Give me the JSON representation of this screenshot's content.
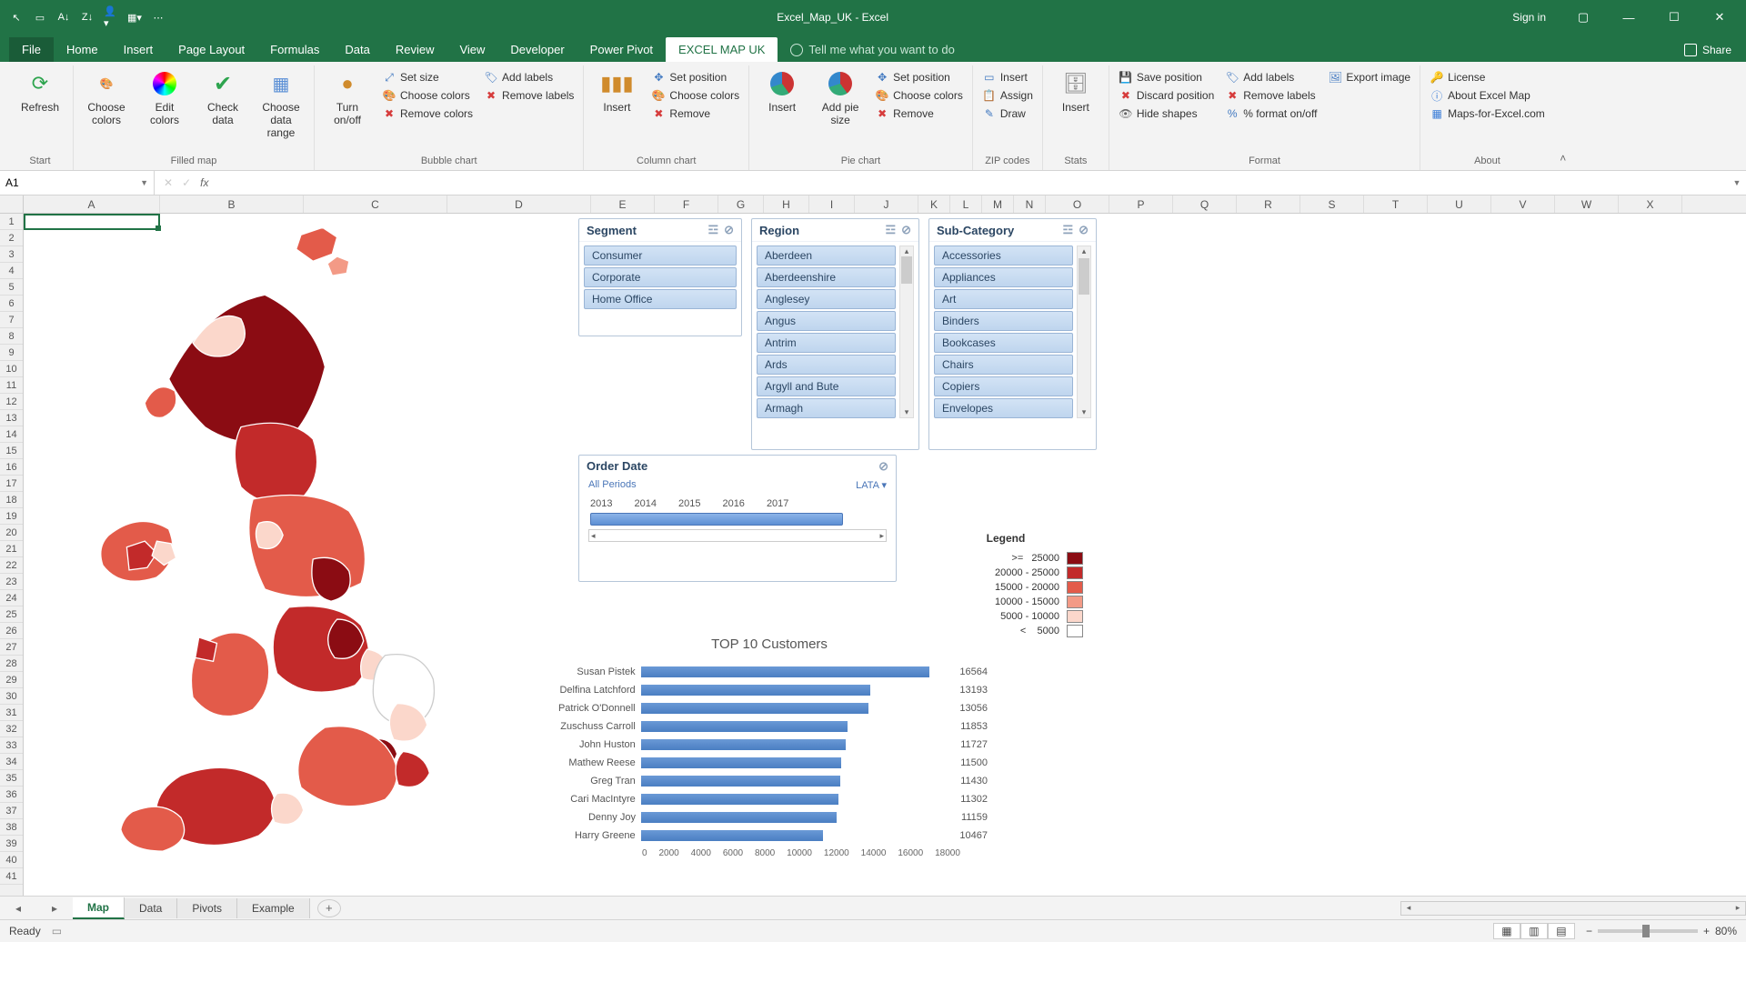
{
  "titlebar": {
    "title": "Excel_Map_UK - Excel",
    "signin": "Sign in"
  },
  "tabs": [
    "File",
    "Home",
    "Insert",
    "Page Layout",
    "Formulas",
    "Data",
    "Review",
    "View",
    "Developer",
    "Power Pivot",
    "EXCEL MAP UK"
  ],
  "active_tab": "EXCEL MAP UK",
  "tellme": "Tell me what you want to do",
  "share": "Share",
  "ribbon": {
    "groups": [
      {
        "label": "Start",
        "big": [
          {
            "label": "Refresh"
          }
        ]
      },
      {
        "label": "Filled map",
        "big": [
          {
            "label": "Choose colors"
          },
          {
            "label": "Edit colors"
          },
          {
            "label": "Check data"
          },
          {
            "label": "Choose data range"
          }
        ]
      },
      {
        "label": "Bubble chart",
        "big": [
          {
            "label": "Turn on/off"
          }
        ],
        "small": [
          [
            "Set size",
            "Choose colors",
            "Remove colors"
          ],
          [
            "Add labels",
            "Remove labels"
          ]
        ]
      },
      {
        "label": "Column chart",
        "big": [
          {
            "label": "Insert"
          }
        ],
        "small": [
          [
            "Set position",
            "Choose colors",
            "Remove"
          ]
        ]
      },
      {
        "label": "Pie chart",
        "big": [
          {
            "label": "Insert"
          },
          {
            "label": "Add pie size"
          }
        ],
        "small": [
          [
            "Set position",
            "Choose colors",
            "Remove"
          ]
        ]
      },
      {
        "label": "ZIP codes",
        "big": [
          {
            "label": "Insert"
          }
        ],
        "small": [
          [
            "Insert",
            "Assign",
            "Draw"
          ]
        ]
      },
      {
        "label": "Stats",
        "big": [
          {
            "label": "Insert"
          }
        ]
      },
      {
        "label": "Format",
        "small": [
          [
            "Save position",
            "Discard position",
            "Hide shapes"
          ],
          [
            "Add labels",
            "Remove labels",
            "% format on/off"
          ],
          [
            "Export image"
          ]
        ]
      },
      {
        "label": "About",
        "small": [
          [
            "License",
            "About Excel Map",
            "Maps-for-Excel.com"
          ]
        ]
      }
    ]
  },
  "namebox": "A1",
  "columns": [
    {
      "l": "A",
      "w": 150
    },
    {
      "l": "B",
      "w": 158
    },
    {
      "l": "C",
      "w": 158
    },
    {
      "l": "D",
      "w": 158
    },
    {
      "l": "E",
      "w": 70
    },
    {
      "l": "F",
      "w": 70
    },
    {
      "l": "G",
      "w": 50
    },
    {
      "l": "H",
      "w": 50
    },
    {
      "l": "I",
      "w": 50
    },
    {
      "l": "J",
      "w": 70
    },
    {
      "l": "K",
      "w": 35
    },
    {
      "l": "L",
      "w": 35
    },
    {
      "l": "M",
      "w": 35
    },
    {
      "l": "N",
      "w": 35
    },
    {
      "l": "O",
      "w": 70
    },
    {
      "l": "P",
      "w": 70
    },
    {
      "l": "Q",
      "w": 70
    },
    {
      "l": "R",
      "w": 70
    },
    {
      "l": "S",
      "w": 70
    },
    {
      "l": "T",
      "w": 70
    },
    {
      "l": "U",
      "w": 70
    },
    {
      "l": "V",
      "w": 70
    },
    {
      "l": "W",
      "w": 70
    },
    {
      "l": "X",
      "w": 70
    }
  ],
  "row_count": 41,
  "slicers": {
    "segment": {
      "title": "Segment",
      "items": [
        "Consumer",
        "Corporate",
        "Home Office"
      ]
    },
    "region": {
      "title": "Region",
      "items": [
        "Aberdeen",
        "Aberdeenshire",
        "Anglesey",
        "Angus",
        "Antrim",
        "Ards",
        "Argyll and Bute",
        "Armagh"
      ]
    },
    "subcat": {
      "title": "Sub-Category",
      "items": [
        "Accessories",
        "Appliances",
        "Art",
        "Binders",
        "Bookcases",
        "Chairs",
        "Copiers",
        "Envelopes"
      ]
    }
  },
  "timeline": {
    "title": "Order Date",
    "subtitle": "All Periods",
    "unit": "LATA",
    "years": [
      "2013",
      "2014",
      "2015",
      "2016",
      "2017"
    ]
  },
  "legend": {
    "title": "Legend",
    "rows": [
      {
        "label": ">=   25000",
        "color": "#8b0c13"
      },
      {
        "label": "20000 - 25000",
        "color": "#c22a2a"
      },
      {
        "label": "15000 - 20000",
        "color": "#e35b4a"
      },
      {
        "label": "10000 - 15000",
        "color": "#f39a86"
      },
      {
        "label": "5000 - 10000",
        "color": "#fbd7cb"
      },
      {
        "label": "<    5000",
        "color": "#ffffff"
      }
    ]
  },
  "chart_data": {
    "type": "bar",
    "title": "TOP 10 Customers",
    "xlabel": "",
    "ylabel": "",
    "xlim": [
      0,
      18000
    ],
    "ticks": [
      0,
      2000,
      4000,
      6000,
      8000,
      10000,
      12000,
      14000,
      16000,
      18000
    ],
    "categories": [
      "Susan Pistek",
      "Delfina Latchford",
      "Patrick O'Donnell",
      "Zuschuss Carroll",
      "John Huston",
      "Mathew Reese",
      "Greg Tran",
      "Cari MacIntyre",
      "Denny Joy",
      "Harry Greene"
    ],
    "values": [
      16564,
      13193,
      13056,
      11853,
      11727,
      11500,
      11430,
      11302,
      11159,
      10467
    ]
  },
  "sheets": [
    "Map",
    "Data",
    "Pivots",
    "Example"
  ],
  "active_sheet": "Map",
  "status": {
    "ready": "Ready",
    "zoom": "80%"
  }
}
